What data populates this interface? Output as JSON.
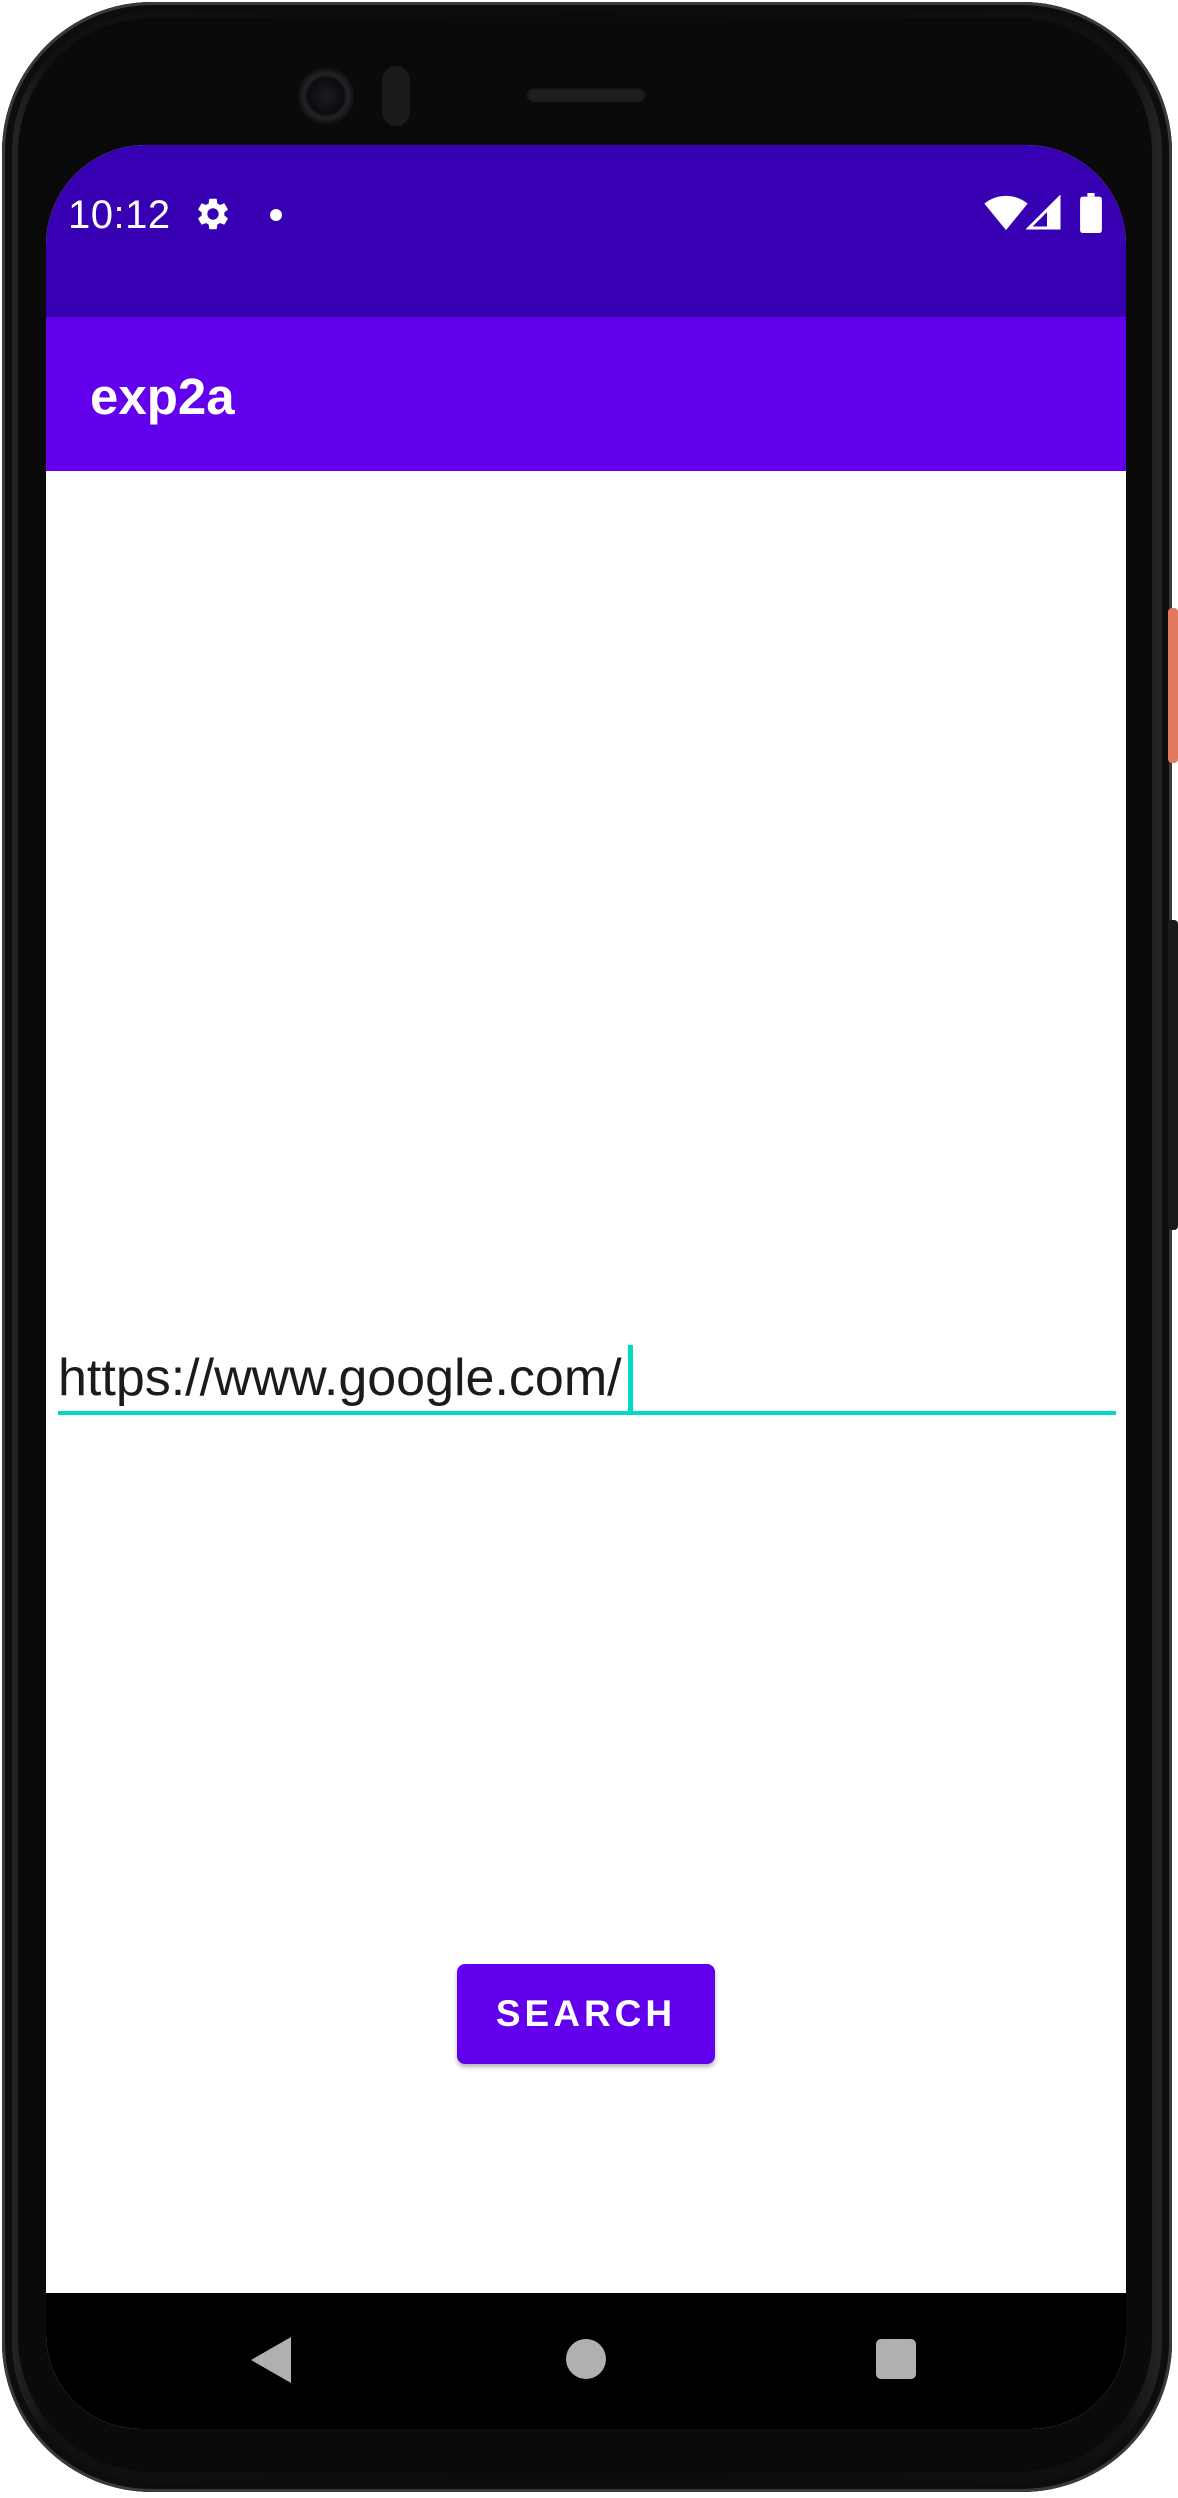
{
  "status_bar": {
    "time": "10:12",
    "icons": [
      "gear-icon",
      "notification-dot-icon",
      "wifi-icon",
      "signal-icon",
      "battery-icon"
    ],
    "color": "#3700b3"
  },
  "app_bar": {
    "title": "exp2a",
    "color": "#6200ee"
  },
  "url_input": {
    "value": "https://www.google.com/",
    "focused": true,
    "underline_color": "#03dac5"
  },
  "search_button": {
    "label": "SEARCH",
    "color": "#6200ee"
  },
  "nav_bar": {
    "icons": [
      "back-icon",
      "home-icon",
      "recents-icon"
    ]
  }
}
